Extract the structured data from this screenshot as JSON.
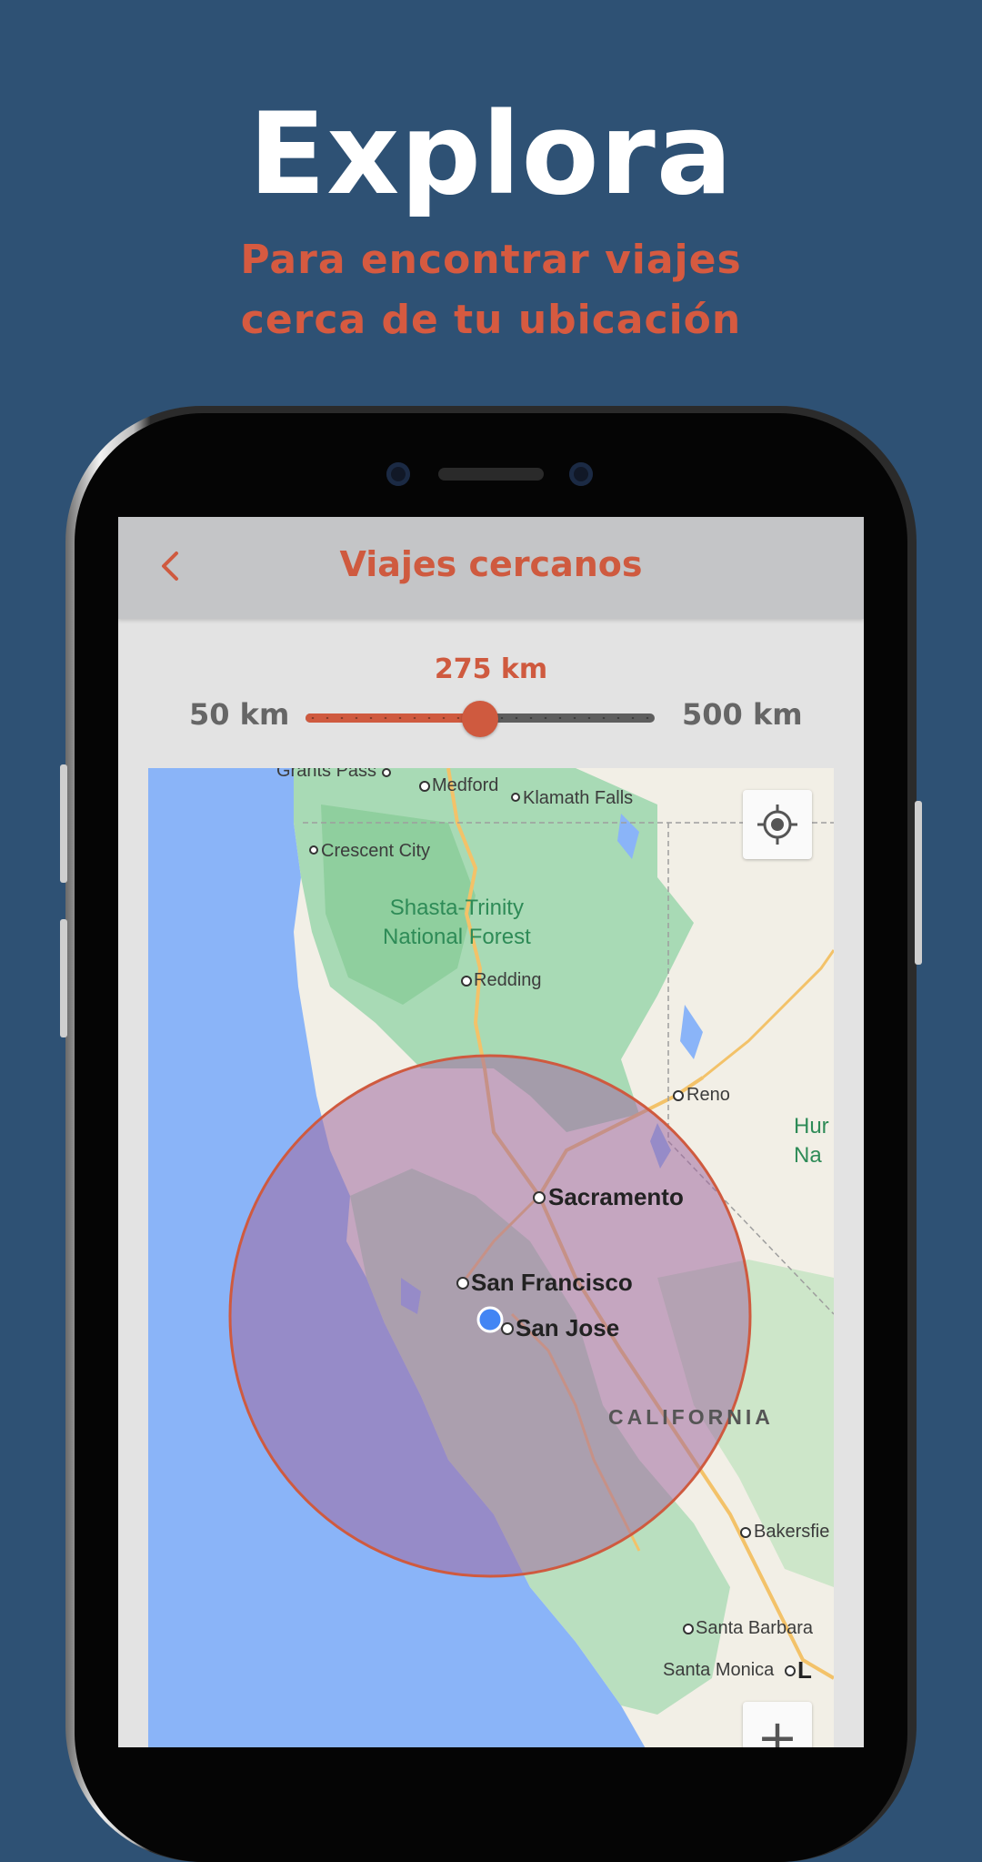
{
  "promo": {
    "title": "Explora",
    "subtitle_line1": "Para encontrar viajes",
    "subtitle_line2": "cerca de tu ubicación"
  },
  "screen": {
    "header": {
      "title": "Viajes cercanos",
      "back_icon": "chevron-left-icon"
    },
    "radius_slider": {
      "value_label": "275 km",
      "min_label": "50 km",
      "max_label": "500 km",
      "min": 50,
      "max": 500,
      "value": 275
    },
    "map": {
      "cities": {
        "grants_pass": "Grants Pass",
        "medford": "Medford",
        "klamath_falls": "Klamath Falls",
        "crescent_city": "Crescent City",
        "redding": "Redding",
        "reno": "Reno",
        "sacramento": "Sacramento",
        "san_francisco": "San Francisco",
        "san_jose": "San Jose",
        "bakersfield": "Bakersfie",
        "santa_barbara": "Santa Barbara",
        "santa_monica": "Santa Monica",
        "la_partial": "L"
      },
      "forest_line1": "Shasta-Trinity",
      "forest_line2": "National Forest",
      "state_label": "CALIFORNIA",
      "park_line1": "Hur",
      "park_line2": "Na",
      "locate_icon": "my-location-icon",
      "zoom_in_label": "+"
    }
  },
  "colors": {
    "background": "#2e5174",
    "accent": "#cf5a3f",
    "title": "#ffffff",
    "radius_circle_fill": "#a06aa0",
    "water": "#8ab4f8"
  }
}
